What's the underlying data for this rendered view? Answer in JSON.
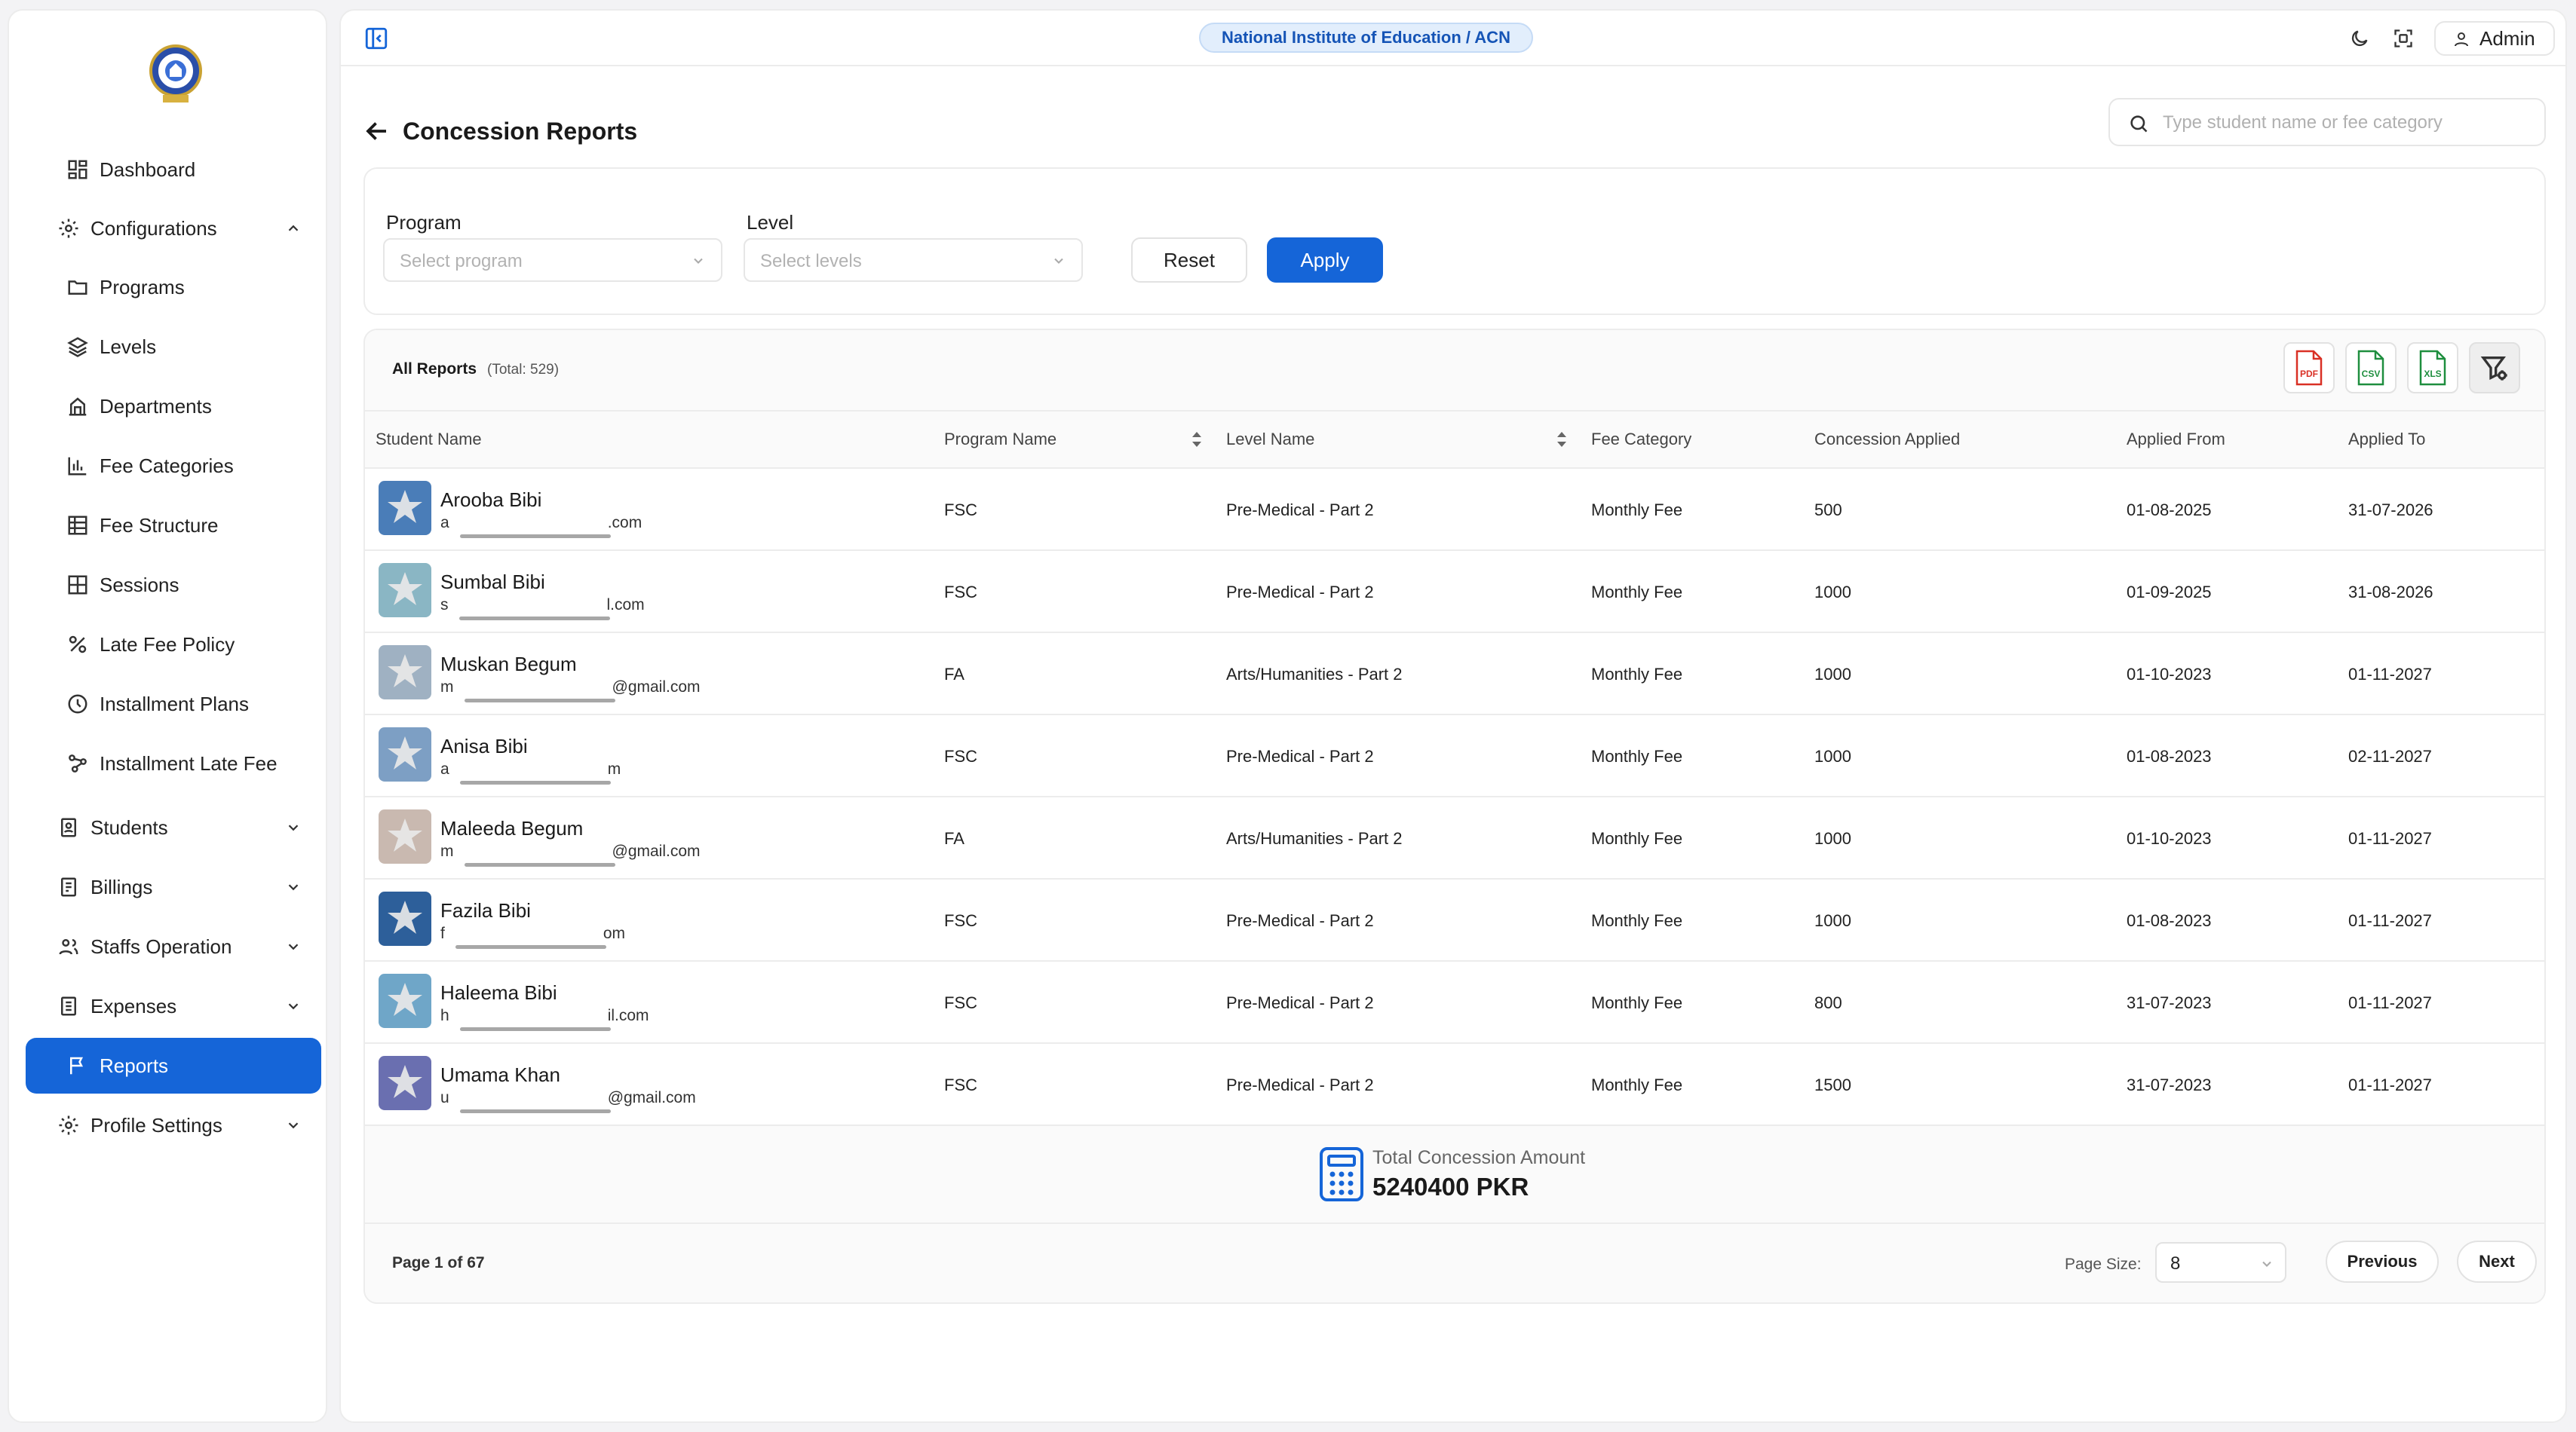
{
  "sidebar": {
    "items": [
      {
        "label": "Dashboard",
        "icon": "dashboard-icon"
      },
      {
        "label": "Configurations",
        "icon": "gear-icon",
        "expanded": true
      },
      {
        "label": "Programs",
        "icon": "folder-icon"
      },
      {
        "label": "Levels",
        "icon": "layers-icon"
      },
      {
        "label": "Departments",
        "icon": "building-icon"
      },
      {
        "label": "Fee Categories",
        "icon": "bar-chart-icon"
      },
      {
        "label": "Fee Structure",
        "icon": "table-icon"
      },
      {
        "label": "Sessions",
        "icon": "grid-icon"
      },
      {
        "label": "Late Fee Policy",
        "icon": "percent-icon"
      },
      {
        "label": "Installment Plans",
        "icon": "clock-icon"
      },
      {
        "label": "Installment Late Fee",
        "icon": "nodes-icon"
      },
      {
        "label": "Students",
        "icon": "student-book-icon"
      },
      {
        "label": "Billings",
        "icon": "receipt-icon"
      },
      {
        "label": "Staffs Operation",
        "icon": "users-icon"
      },
      {
        "label": "Expenses",
        "icon": "wallet-icon"
      },
      {
        "label": "Reports",
        "icon": "flag-icon",
        "active": true
      },
      {
        "label": "Profile Settings",
        "icon": "gear-icon"
      }
    ]
  },
  "header": {
    "institute": "National Institute of Education / ACN",
    "user": "Admin"
  },
  "page": {
    "title": "Concession Reports",
    "search_placeholder": "Type student name or fee category"
  },
  "filters": {
    "program_label": "Program",
    "program_placeholder": "Select program",
    "level_label": "Level",
    "level_placeholder": "Select levels",
    "reset": "Reset",
    "apply": "Apply"
  },
  "reports": {
    "title": "All Reports",
    "total": "(Total: 529)",
    "exports": [
      "PDF",
      "CSV",
      "XLS"
    ],
    "columns": [
      "Student Name",
      "Program Name",
      "Level Name",
      "Fee Category",
      "Concession Applied",
      "Applied From",
      "Applied To"
    ],
    "rows": [
      {
        "name": "Arooba Bibi",
        "email_start": "a",
        "email_end": ".com",
        "program": "FSC",
        "level": "Pre-Medical - Part 2",
        "fee": "Monthly Fee",
        "concession": "500",
        "from": "01-08-2025",
        "to": "31-07-2026"
      },
      {
        "name": "Sumbal Bibi",
        "email_start": "s",
        "email_end": "l.com",
        "program": "FSC",
        "level": "Pre-Medical - Part 2",
        "fee": "Monthly Fee",
        "concession": "1000",
        "from": "01-09-2025",
        "to": "31-08-2026"
      },
      {
        "name": "Muskan Begum",
        "email_start": "m",
        "email_end": "@gmail.com",
        "program": "FA",
        "level": "Arts/Humanities - Part 2",
        "fee": "Monthly Fee",
        "concession": "1000",
        "from": "01-10-2023",
        "to": "01-11-2027"
      },
      {
        "name": "Anisa Bibi",
        "email_start": "a",
        "email_end": "m",
        "program": "FSC",
        "level": "Pre-Medical - Part 2",
        "fee": "Monthly Fee",
        "concession": "1000",
        "from": "01-08-2023",
        "to": "02-11-2027"
      },
      {
        "name": "Maleeda Begum",
        "email_start": "m",
        "email_end": "@gmail.com",
        "program": "FA",
        "level": "Arts/Humanities - Part 2",
        "fee": "Monthly Fee",
        "concession": "1000",
        "from": "01-10-2023",
        "to": "01-11-2027"
      },
      {
        "name": "Fazila Bibi",
        "email_start": "f",
        "email_end": "om",
        "program": "FSC",
        "level": "Pre-Medical - Part 2",
        "fee": "Monthly Fee",
        "concession": "1000",
        "from": "01-08-2023",
        "to": "01-11-2027"
      },
      {
        "name": "Haleema Bibi",
        "email_start": "h",
        "email_end": "il.com",
        "program": "FSC",
        "level": "Pre-Medical - Part 2",
        "fee": "Monthly Fee",
        "concession": "800",
        "from": "31-07-2023",
        "to": "01-11-2027"
      },
      {
        "name": "Umama Khan",
        "email_start": "u",
        "email_end": "@gmail.com",
        "program": "FSC",
        "level": "Pre-Medical - Part 2",
        "fee": "Monthly Fee",
        "concession": "1500",
        "from": "31-07-2023",
        "to": "01-11-2027"
      }
    ],
    "total_label": "Total Concession Amount",
    "total_value": "5240400 PKR",
    "page_info": "Page 1 of 67",
    "page_size_label": "Page Size:",
    "page_size": "8",
    "previous": "Previous",
    "next": "Next"
  },
  "colors": {
    "accent": "#1565d8",
    "pdf": "#d93025",
    "csv": "#1e8e3e",
    "xls": "#1e8e3e"
  }
}
